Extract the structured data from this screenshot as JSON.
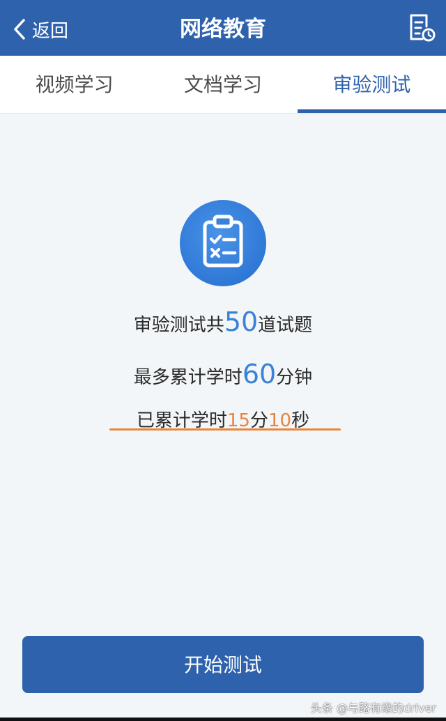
{
  "header": {
    "back_label": "返回",
    "title": "网络教育",
    "back_icon": "chevron-left-icon",
    "record_icon": "document-clock-icon"
  },
  "tabs": [
    {
      "label": "视频学习",
      "active": false
    },
    {
      "label": "文档学习",
      "active": false
    },
    {
      "label": "审验测试",
      "active": true
    }
  ],
  "main": {
    "icon": "clipboard-checklist-icon",
    "line1": {
      "prefix": "审验测试共",
      "num": "50",
      "suffix": "道试题"
    },
    "line2": {
      "prefix": "最多累计学时",
      "num": "60",
      "suffix": "分钟"
    },
    "line3": {
      "prefix": "已累计学时",
      "min": "15",
      "min_unit": "分",
      "sec": "10",
      "sec_unit": "秒"
    }
  },
  "start_button": {
    "label": "开始测试"
  },
  "watermark": "头条 @与路有缘的driver",
  "colors": {
    "primary": "#2e62ad",
    "accent_blue": "#3a82d6",
    "accent_orange": "#e9853b",
    "background": "#f3f6f8"
  }
}
